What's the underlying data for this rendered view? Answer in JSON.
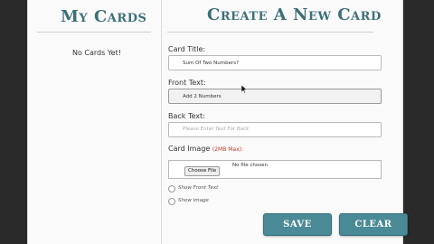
{
  "left": {
    "title": "My Cards",
    "empty_text": "No Cards Yet!"
  },
  "form": {
    "title": "Create A New Card",
    "card_title": {
      "label": "Card Title:",
      "value": "Sum Of Two Numbers?"
    },
    "front_text": {
      "label": "Front Text:",
      "value": "Add 2 Numbers"
    },
    "back_text": {
      "label": "Back Text:",
      "placeholder": "Please Enter Text For Back"
    },
    "card_image": {
      "label": "Card Image",
      "note": "(2MB Max):",
      "button": "Choose File",
      "status": "No file chosen"
    },
    "show_front_text": "Show Front Text",
    "show_image": "Show Image",
    "save": "SAVE",
    "clear": "CLEAR"
  },
  "colors": {
    "accent": "#3d6f78",
    "button": "#4a8a96",
    "required_note": "#c0392b"
  }
}
